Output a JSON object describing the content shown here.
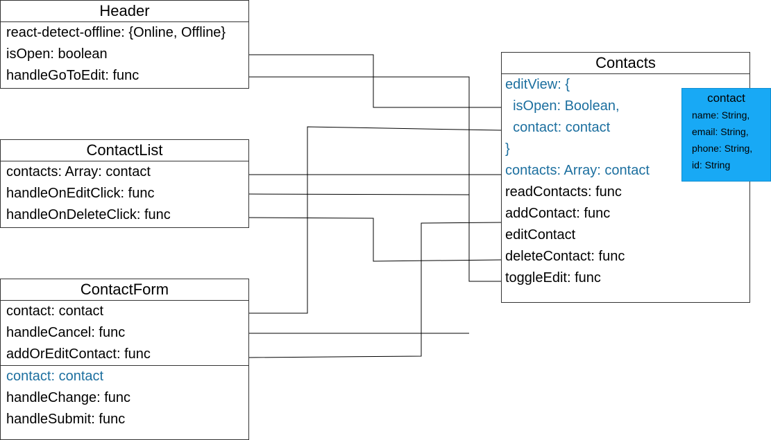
{
  "header": {
    "title": "Header",
    "fields": [
      "react-detect-offline: {Online, Offline}",
      "isOpen: boolean",
      "handleGoToEdit: func"
    ]
  },
  "contact_list": {
    "title": "ContactList",
    "fields": [
      "contacts: Array: contact",
      "handleOnEditClick: func",
      "handleOnDeleteClick: func"
    ]
  },
  "contact_form": {
    "title": "ContactForm",
    "props": [
      "contact: contact",
      "handleCancel: func",
      "addOrEditContact: func"
    ],
    "state": [
      "contact: contact"
    ],
    "methods": [
      "handleChange: func",
      "handleSubmit: func"
    ]
  },
  "contacts": {
    "title": "Contacts",
    "state": [
      "editView: {",
      "  isOpen: Boolean,",
      "  contact: contact",
      "}",
      "contacts: Array: contact"
    ],
    "methods": [
      "readContacts: func",
      "addContact: func",
      "editContact",
      "deleteContact: func",
      "toggleEdit: func"
    ]
  },
  "contact_type": {
    "title": "contact",
    "fields": [
      "name: String,",
      "email: String,",
      "phone: String,",
      "id: String"
    ]
  },
  "colors": {
    "state_text": "#1c6f9f",
    "note_bg": "#18a9f5",
    "line": "#000000"
  }
}
